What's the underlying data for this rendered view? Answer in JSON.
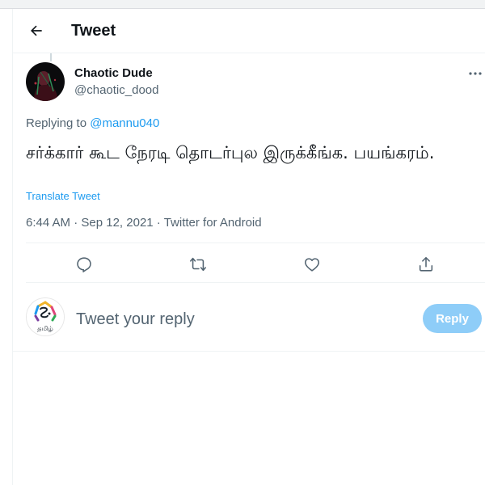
{
  "header": {
    "title": "Tweet",
    "back_icon": "arrow-left-icon"
  },
  "tweet": {
    "author_name": "Chaotic Dude",
    "author_handle": "@chaotic_dood",
    "replying_prefix": "Replying to ",
    "replying_to": "@mannu040",
    "text": "சர்க்கார் கூட நேரடி தொடர்புல இருக்கீங்க. பயங்கரம்.",
    "translate_label": "Translate Tweet",
    "time": "6:44 AM",
    "separator": " · ",
    "date": "Sep 12, 2021",
    "source": "Twitter for Android"
  },
  "actions": [
    "reply-icon",
    "retweet-icon",
    "like-icon",
    "share-icon"
  ],
  "reply_box": {
    "placeholder": "Tweet your reply",
    "button_label": "Reply",
    "avatar_text": "தமிழ்"
  },
  "colors": {
    "accent": "#1d9bf0",
    "reply_button_disabled": "#8ecdf8",
    "secondary_text": "#536471",
    "primary_text": "#0f1419",
    "divider": "#eff3f4"
  }
}
